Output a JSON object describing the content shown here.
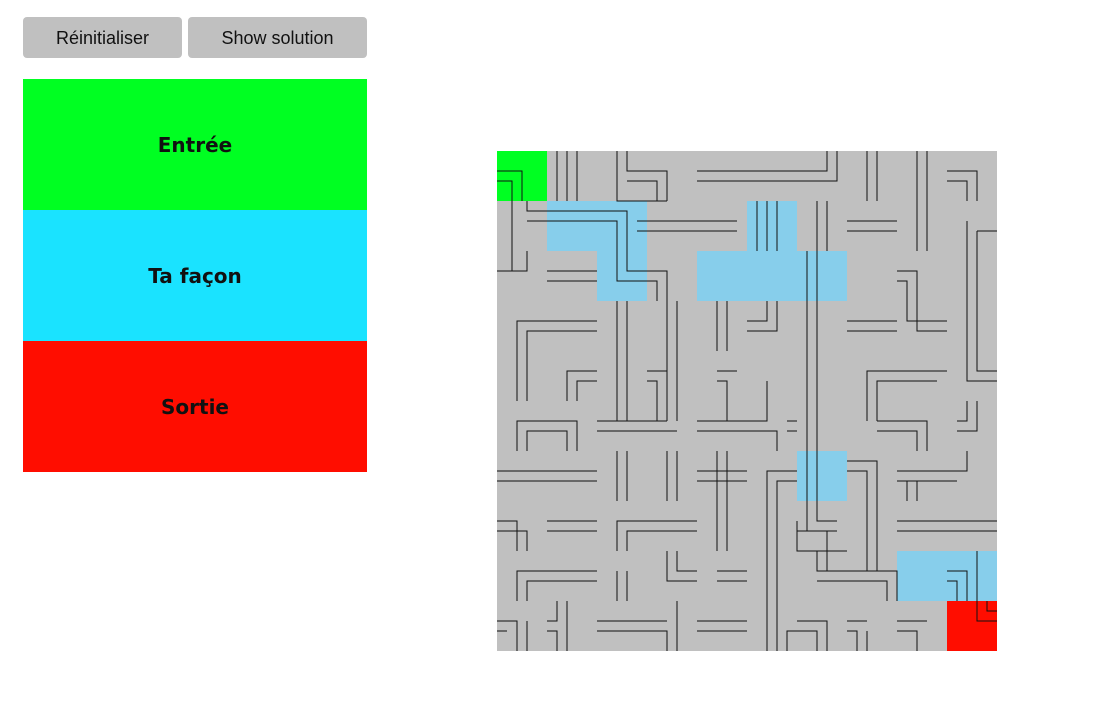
{
  "controls": {
    "reset_label": "Réinitialiser",
    "solution_label": "Show solution"
  },
  "legend": {
    "entry_label": "Entrée",
    "path_label": "Ta façon",
    "exit_label": "Sortie",
    "entry_color": "#00ff22",
    "path_color": "#1ae3ff",
    "exit_color": "#ff0d00"
  },
  "maze": {
    "rows": 10,
    "cols": 10,
    "background_color": "#c0c0c0",
    "path_cell_color": "#87ceeb",
    "entry_cell": [
      0,
      0
    ],
    "exit_cell": [
      9,
      9
    ],
    "player_path_cells": [
      [
        1,
        1
      ],
      [
        1,
        2
      ],
      [
        2,
        2
      ],
      [
        1,
        5
      ],
      [
        2,
        4
      ],
      [
        2,
        5
      ],
      [
        2,
        6
      ],
      [
        6,
        6
      ],
      [
        8,
        8
      ],
      [
        8,
        9
      ]
    ]
  }
}
